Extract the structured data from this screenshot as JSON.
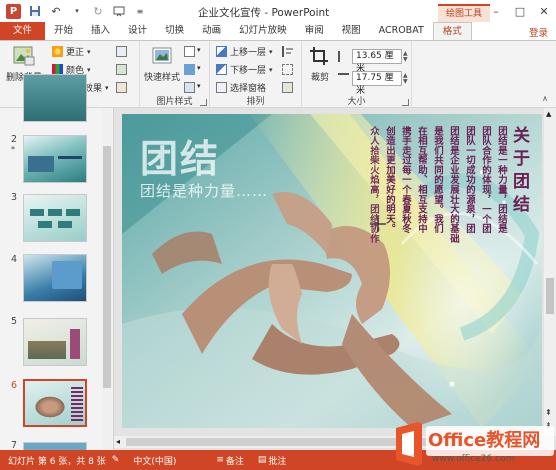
{
  "window": {
    "title": "企业文化宣传 - PowerPoint",
    "help": "?",
    "min": "–",
    "restore": "□",
    "close": "✕"
  },
  "context_tab": {
    "label": "绘图工具"
  },
  "tabs": [
    {
      "label": "文件",
      "kind": "file"
    },
    {
      "label": "开始"
    },
    {
      "label": "插入"
    },
    {
      "label": "设计"
    },
    {
      "label": "切换"
    },
    {
      "label": "动画"
    },
    {
      "label": "幻灯片放映"
    },
    {
      "label": "审阅"
    },
    {
      "label": "视图"
    },
    {
      "label": "ACROBAT"
    },
    {
      "label": "格式",
      "active": true
    }
  ],
  "login": "登录",
  "ribbon": {
    "remove_bg": "删除背景",
    "correction": "更正",
    "color": "颜色",
    "art_effects": "艺术效果",
    "group_adjust": "调整",
    "quick_styles": "快速样式",
    "group_picstyle": "图片样式",
    "bring_forward": "上移一层",
    "send_backward": "下移一层",
    "selection_pane": "选择窗格",
    "group_arrange": "排列",
    "crop": "裁剪",
    "height": "13.65 厘米",
    "width": "17.75 厘米",
    "group_size": "大小"
  },
  "thumbnails": [
    {
      "num": "2",
      "star": "*"
    },
    {
      "num": "3"
    },
    {
      "num": "4"
    },
    {
      "num": "5"
    },
    {
      "num": "6",
      "selected": true
    },
    {
      "num": "7"
    }
  ],
  "slide": {
    "title": "团结",
    "subtitle": "团结是种力量……",
    "heading": "关于团结",
    "body_columns": [
      "团结是一种力量，团结是",
      "团队合作的体现，一个团",
      "团队一切成功的源泉，团",
      "团结是企业发展壮大的基础",
      "是我们共同的愿望。我们",
      "在相互帮助、相互支持中",
      "携手走过每一个春夏秋冬",
      "创造出更加美好的明天。",
      "众人拾柴火焰高，团结协作"
    ]
  },
  "statusbar": {
    "slide_info": "幻灯片 第 6 张，共 8 张",
    "language": "中文(中国)",
    "notes": "备注",
    "comments": "批注"
  },
  "watermark": {
    "brand": "Office教程网",
    "url": "www.office26.com"
  },
  "colors": {
    "accent": "#d04525",
    "slide_teal": "#2d8c8c",
    "slide_text_purple": "#6a1f55"
  }
}
